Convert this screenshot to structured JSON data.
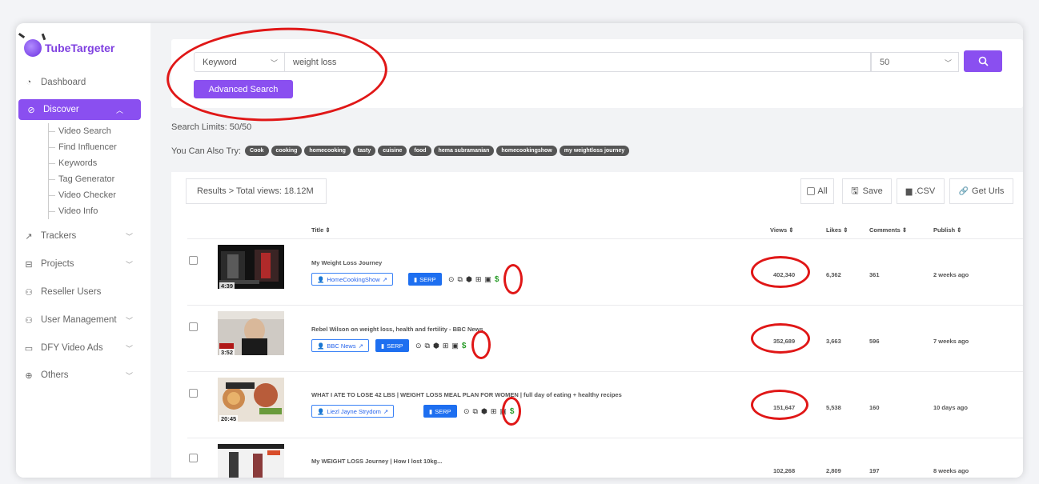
{
  "app": {
    "name": "TubeTargeter"
  },
  "sidebar": {
    "items": [
      {
        "label": "Dashboard",
        "icon": "dashboard-icon"
      },
      {
        "label": "Discover",
        "icon": "compass-icon",
        "active": true
      },
      {
        "label": "Trackers",
        "icon": "trend-icon"
      },
      {
        "label": "Projects",
        "icon": "briefcase-icon"
      },
      {
        "label": "Reseller Users",
        "icon": "user-icon"
      },
      {
        "label": "User Management",
        "icon": "user-icon"
      },
      {
        "label": "DFY Video Ads",
        "icon": "video-icon"
      },
      {
        "label": "Others",
        "icon": "plus-circle-icon"
      }
    ],
    "discover_sub": [
      "Video Search",
      "Find Influencer",
      "Keywords",
      "Tag Generator",
      "Video Checker",
      "Video Info"
    ]
  },
  "search": {
    "type_value": "Keyword",
    "query": "weight loss",
    "count": "50",
    "advanced_label": "Advanced Search"
  },
  "limits_text": "Search Limits: 50/50",
  "try": {
    "label": "You Can Also Try:",
    "chips": [
      "Cook",
      "cooking",
      "homecooking",
      "tasty",
      "cuisine",
      "food",
      "hema subramanian",
      "homecookingshow",
      "my weightloss journey"
    ]
  },
  "results": {
    "total_label": "Results > Total views: 18.12M",
    "tools": {
      "all": "All",
      "save": "Save",
      "csv": ".CSV",
      "urls": "Get Urls"
    },
    "headers": {
      "title": "Title ⇕",
      "views": "Views ⇕",
      "likes": "Likes ⇕",
      "comments": "Comments ⇕",
      "publish": "Publish ⇕"
    },
    "serp_label": "SERP",
    "rows": [
      {
        "title": "My Weight Loss Journey",
        "channel": "HomeCookingShow",
        "duration": "4:39",
        "views": "402,340",
        "likes": "6,362",
        "comments": "361",
        "publish": "2 weeks ago"
      },
      {
        "title": "Rebel Wilson on weight loss, health and fertility - BBC News",
        "channel": "BBC News",
        "duration": "3:52",
        "views": "352,689",
        "likes": "3,663",
        "comments": "596",
        "publish": "7 weeks ago"
      },
      {
        "title": "WHAT I ATE TO LOSE 42 LBS | WEIGHT LOSS MEAL PLAN FOR WOMEN | full day of eating + healthy recipes",
        "channel": "Liezl Jayne Strydom",
        "duration": "20:45",
        "views": "151,647",
        "likes": "5,538",
        "comments": "160",
        "publish": "10 days ago"
      },
      {
        "title": "My WEIGHT LOSS Journey | How I lost 10kg...",
        "channel": "",
        "duration": "",
        "views": "102,268",
        "likes": "2,809",
        "comments": "197",
        "publish": "8 weeks ago"
      }
    ]
  },
  "colors": {
    "accent": "#8a4ff0",
    "serp": "#1e6ff0",
    "annotation": "#e01717",
    "dollar": "#2a9d2a"
  }
}
